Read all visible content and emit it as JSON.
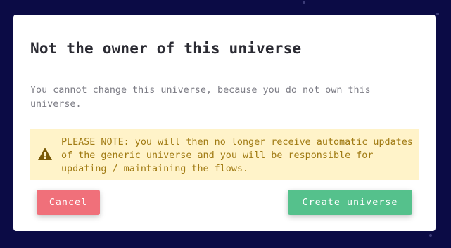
{
  "dialog": {
    "title": "Not the owner of this universe",
    "message": "You cannot change this universe, because you do not own this universe.",
    "warning": {
      "icon": "warning-triangle-icon",
      "text": "PLEASE NOTE: you will then no longer receive automatic updates of the generic universe and you will be responsible for updating / maintaining the flows."
    },
    "buttons": {
      "cancel_label": "Cancel",
      "create_label": "Create universe"
    }
  },
  "colors": {
    "backdrop": "#0b0b45",
    "cancel": "#f0707a",
    "create": "#55c18c",
    "warning_bg": "#fff3c9",
    "warning_text": "#a07a12",
    "warning_icon": "#7a5a08"
  }
}
